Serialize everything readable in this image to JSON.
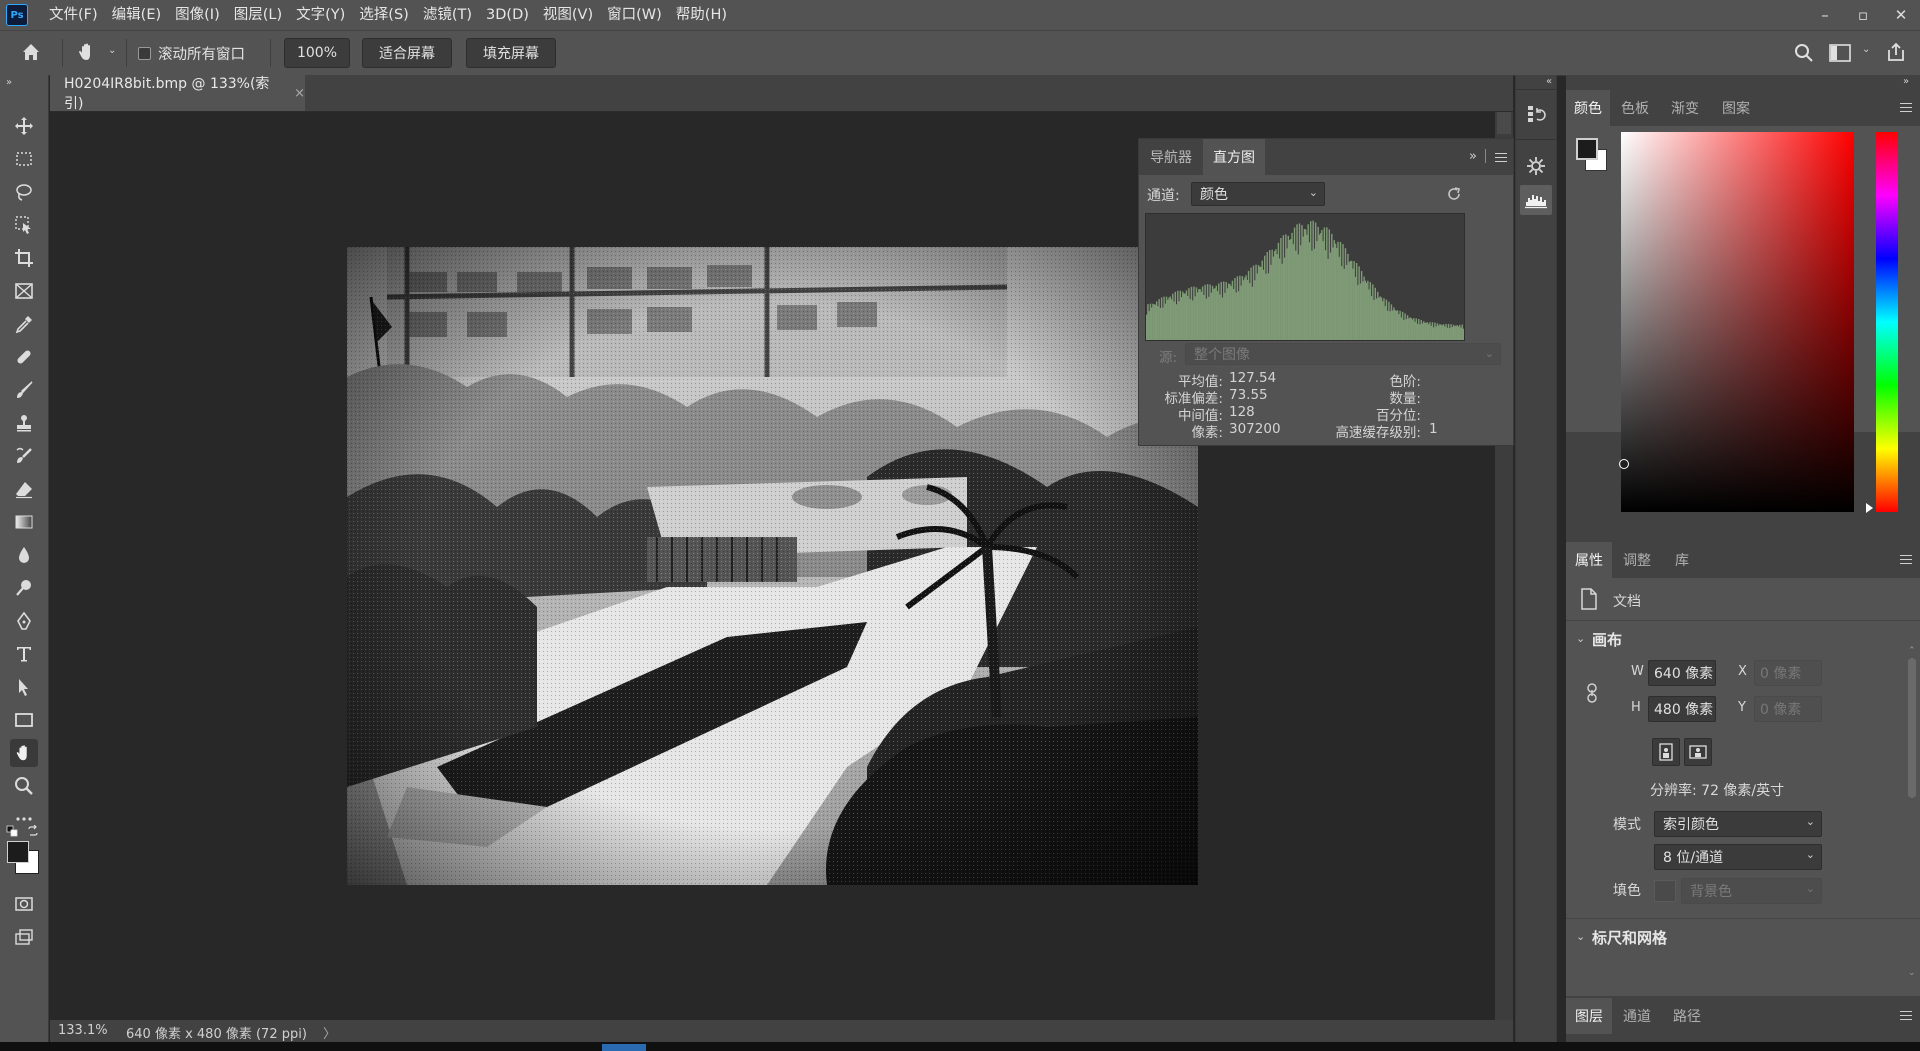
{
  "app": {
    "logo": "Ps"
  },
  "menu": [
    "文件(F)",
    "编辑(E)",
    "图像(I)",
    "图层(L)",
    "文字(Y)",
    "选择(S)",
    "滤镜(T)",
    "3D(D)",
    "视图(V)",
    "窗口(W)",
    "帮助(H)"
  ],
  "window_controls": {
    "minimize": "–",
    "restore": "▫",
    "close": "✕"
  },
  "options": {
    "scroll_all_label": "滚动所有窗口",
    "zoom_value": "100%",
    "fit_screen": "适合屏幕",
    "fill_screen": "填充屏幕"
  },
  "document": {
    "tab_title": "H0204IR8bit.bmp @ 133%(索引)",
    "tab_close": "×"
  },
  "status": {
    "zoom": "133.1%",
    "info": "640 像素 x 480 像素 (72 ppi)",
    "arrow": "〉"
  },
  "histogram_panel": {
    "tabs": [
      "导航器",
      "直方图"
    ],
    "active_tab": "直方图",
    "channel_label": "通道:",
    "channel_value": "颜色",
    "source_label": "源:",
    "source_value": "整个图像",
    "stats_left": [
      {
        "label": "平均值:",
        "value": "127.54"
      },
      {
        "label": "标准偏差:",
        "value": "73.55"
      },
      {
        "label": "中间值:",
        "value": "128"
      },
      {
        "label": "像素:",
        "value": "307200"
      }
    ],
    "stats_right": [
      {
        "label": "色阶:",
        "value": ""
      },
      {
        "label": "数量:",
        "value": ""
      },
      {
        "label": "百分位:",
        "value": ""
      },
      {
        "label": "高速缓存级别:",
        "value": "1"
      }
    ],
    "graph_color": "#7f9a76"
  },
  "color_panel": {
    "tabs": [
      "颜色",
      "色板",
      "渐变",
      "图案"
    ],
    "active_tab": "颜色",
    "foreground": "#1c1c1c",
    "background": "#ffffff",
    "hue_color": "#ff0000"
  },
  "properties_panel": {
    "tabs": [
      "属性",
      "调整",
      "库"
    ],
    "active_tab": "属性",
    "doc_label": "文档",
    "canvas_section": "画布",
    "w_label": "W",
    "w_value": "640 像素",
    "h_label": "H",
    "h_value": "480 像素",
    "x_label": "X",
    "x_value": "0 像素",
    "y_label": "Y",
    "y_value": "0 像素",
    "resolution": "分辨率: 72 像素/英寸",
    "mode_label": "模式",
    "mode_value": "索引颜色",
    "depth_value": "8 位/通道",
    "fill_label": "填色",
    "fill_value": "背景色",
    "rulers_section": "标尺和网格"
  },
  "layers_panel": {
    "tabs": [
      "图层",
      "通道",
      "路径"
    ],
    "active_tab": "图层"
  }
}
